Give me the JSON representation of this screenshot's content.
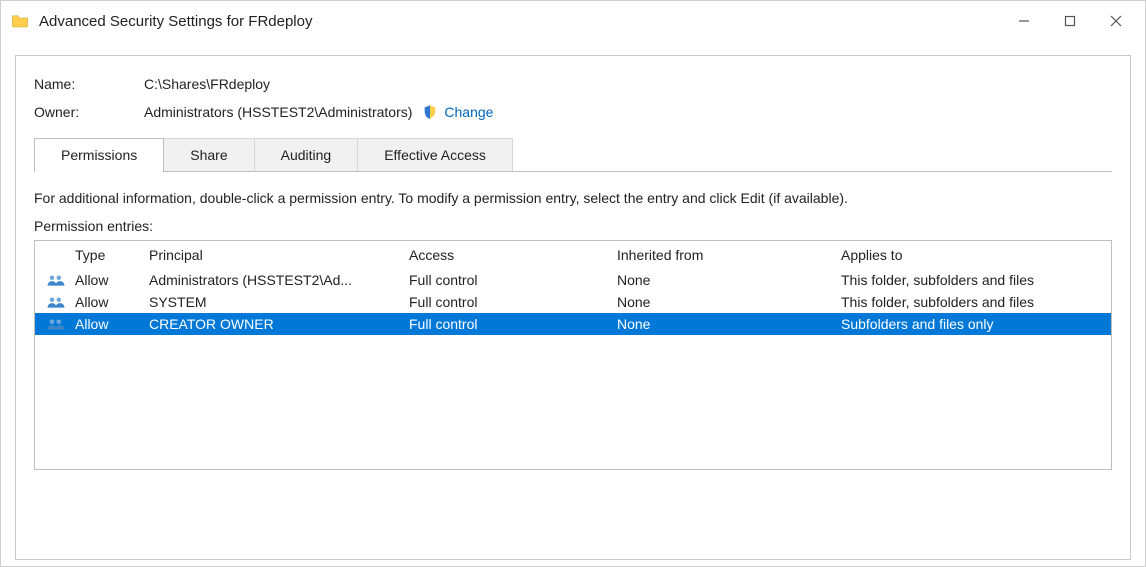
{
  "window": {
    "title": "Advanced Security Settings for FRdeploy"
  },
  "name_label": "Name:",
  "name_value": "C:\\Shares\\FRdeploy",
  "owner_label": "Owner:",
  "owner_value": "Administrators (HSSTEST2\\Administrators)",
  "change_label": "Change",
  "tabs": {
    "permissions": "Permissions",
    "share": "Share",
    "auditing": "Auditing",
    "effective": "Effective Access"
  },
  "description": "For additional information, double-click a permission entry. To modify a permission entry, select the entry and click Edit (if available).",
  "entries_label": "Permission entries:",
  "headers": {
    "type": "Type",
    "principal": "Principal",
    "access": "Access",
    "inherited": "Inherited from",
    "applies": "Applies to"
  },
  "rows": [
    {
      "type": "Allow",
      "principal": "Administrators (HSSTEST2\\Ad...",
      "access": "Full control",
      "inherited": "None",
      "applies": "This folder, subfolders and files",
      "selected": false
    },
    {
      "type": "Allow",
      "principal": "SYSTEM",
      "access": "Full control",
      "inherited": "None",
      "applies": "This folder, subfolders and files",
      "selected": false
    },
    {
      "type": "Allow",
      "principal": "CREATOR OWNER",
      "access": "Full control",
      "inherited": "None",
      "applies": "Subfolders and files only",
      "selected": true
    }
  ]
}
